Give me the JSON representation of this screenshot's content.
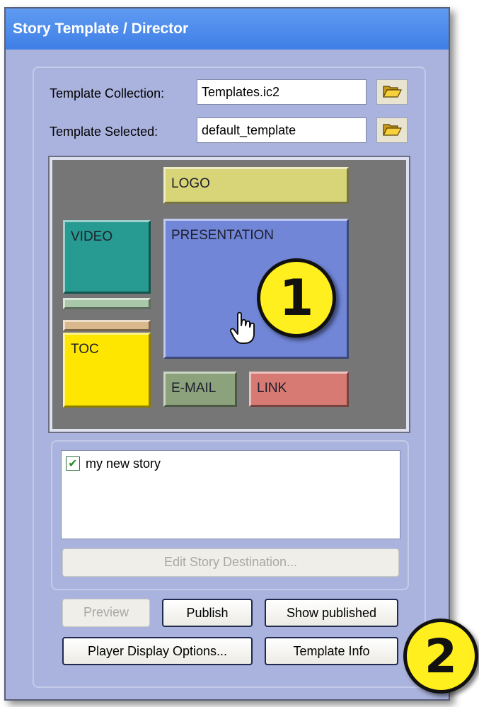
{
  "window": {
    "title": "Story Template / Director"
  },
  "collection": {
    "label": "Template Collection:",
    "value": "Templates.ic2"
  },
  "selected": {
    "label": "Template Selected:",
    "value": "default_template"
  },
  "zones": {
    "logo": "LOGO",
    "video": "VIDEO",
    "presentation": "PRESENTATION",
    "toc": "TOC",
    "email": "E-MAIL",
    "link": "LINK"
  },
  "colors": {
    "logo": "#d8d478",
    "video": "#279a91",
    "presentation": "#7186d7",
    "toc": "#ffe600",
    "email": "#8ba27c",
    "link": "#d77a73",
    "strip1": "#a9c7a9",
    "strip2": "#d9b98c"
  },
  "callouts": {
    "first": "1",
    "second": "2"
  },
  "stories": [
    {
      "label": "my new story",
      "checked": true
    }
  ],
  "buttons": {
    "edit_destination": "Edit Story Destination...",
    "preview": "Preview",
    "publish": "Publish",
    "show_published": "Show published",
    "player_display": "Player Display Options...",
    "template_info": "Template Info"
  }
}
